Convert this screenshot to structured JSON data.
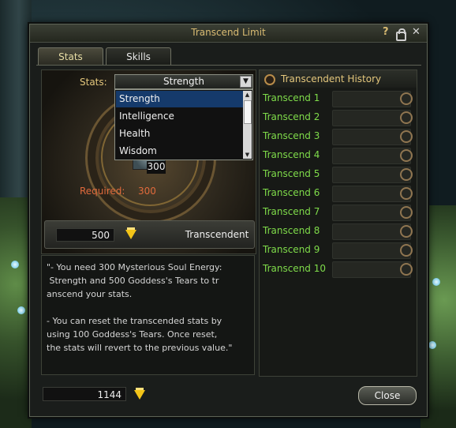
{
  "window": {
    "title": "Transcend Limit"
  },
  "tabs": [
    {
      "label": "Stats"
    },
    {
      "label": "Skills"
    }
  ],
  "stats": {
    "label": "Stats:",
    "selected": "Strength",
    "options": [
      "Strength",
      "Intelligence",
      "Health",
      "Wisdom"
    ],
    "value": "300",
    "required_label": "Required:",
    "required_value": "300"
  },
  "cost": {
    "amount": "500",
    "icon": "goddess-tear-gem-icon",
    "button": "Transcendent"
  },
  "description": {
    "line1": "\"- You need 300 Mysterious Soul Energy:\n Strength and 500 Goddess's Tears to tr\nanscend your stats.",
    "line2": "- You can reset the transcended stats by\nusing 100 Goddess's Tears. Once reset,\nthe stats will revert to the previous value.\""
  },
  "history": {
    "title": "Transcendent History",
    "rows": [
      "Transcend 1",
      "Transcend 2",
      "Transcend 3",
      "Transcend 4",
      "Transcend 5",
      "Transcend 6",
      "Transcend 7",
      "Transcend 8",
      "Transcend 9",
      "Transcend 10"
    ]
  },
  "footer": {
    "currency": "1144",
    "close": "Close"
  },
  "colors": {
    "gold": "#e4c77c",
    "green": "#7fdc4a",
    "red": "#e06a3c",
    "selected": "#153a6b"
  }
}
